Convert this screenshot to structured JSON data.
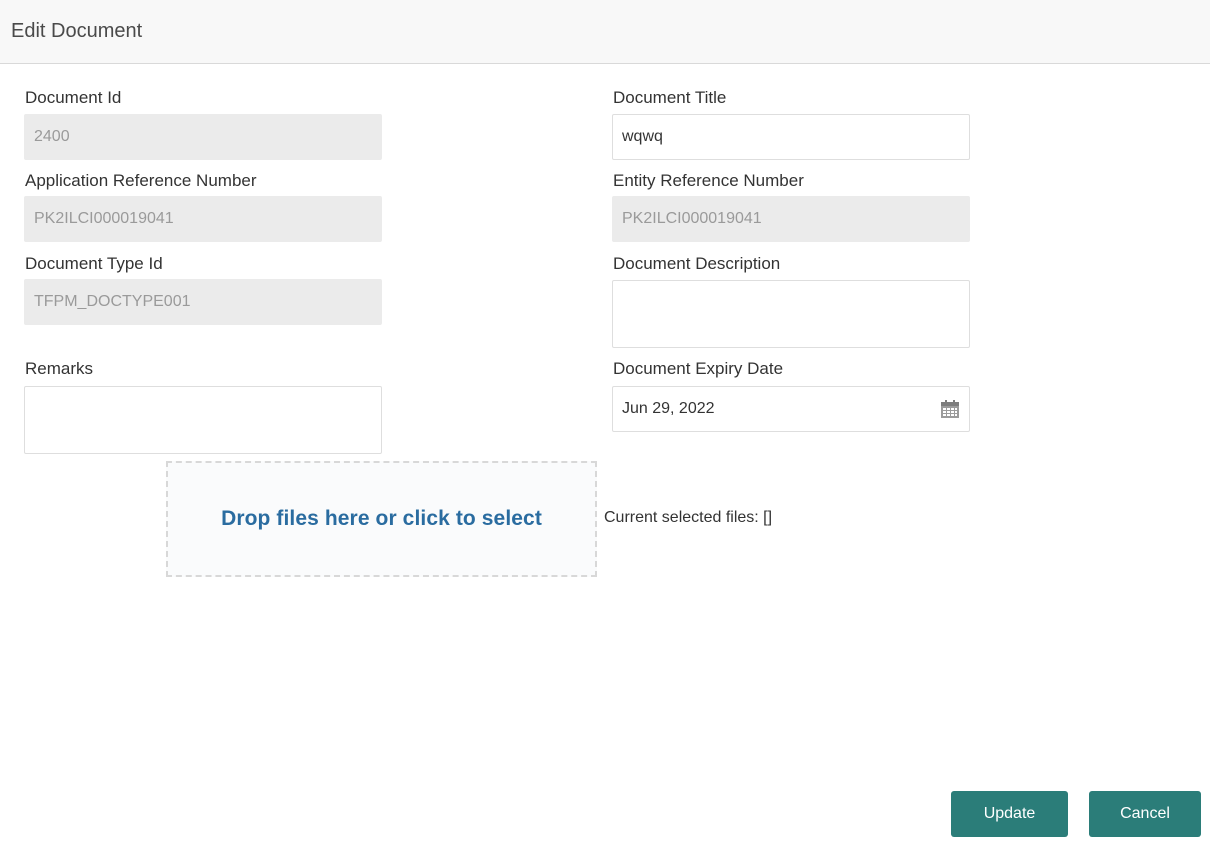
{
  "header": {
    "title": "Edit Document"
  },
  "form": {
    "document_id": {
      "label": "Document Id",
      "value": "2400"
    },
    "document_title": {
      "label": "Document Title",
      "value": "wqwq"
    },
    "application_reference_number": {
      "label": "Application Reference Number",
      "value": "PK2ILCI000019041"
    },
    "entity_reference_number": {
      "label": "Entity Reference Number",
      "value": "PK2ILCI000019041"
    },
    "document_type_id": {
      "label": "Document Type Id",
      "value": "TFPM_DOCTYPE001"
    },
    "document_description": {
      "label": "Document Description",
      "value": ""
    },
    "remarks": {
      "label": "Remarks",
      "value": ""
    },
    "document_expiry_date": {
      "label": "Document Expiry Date",
      "value": "Jun 29, 2022",
      "icon": "calendar-icon"
    }
  },
  "upload": {
    "dropzone_text": "Drop files here or click to select",
    "selected_files_text": "Current selected files: []"
  },
  "buttons": {
    "update": "Update",
    "cancel": "Cancel"
  },
  "colors": {
    "header_bg": "#f8f8f8",
    "readonly_bg": "#ebebeb",
    "link_blue": "#2a6ca0",
    "button_teal": "#2b7d79"
  }
}
